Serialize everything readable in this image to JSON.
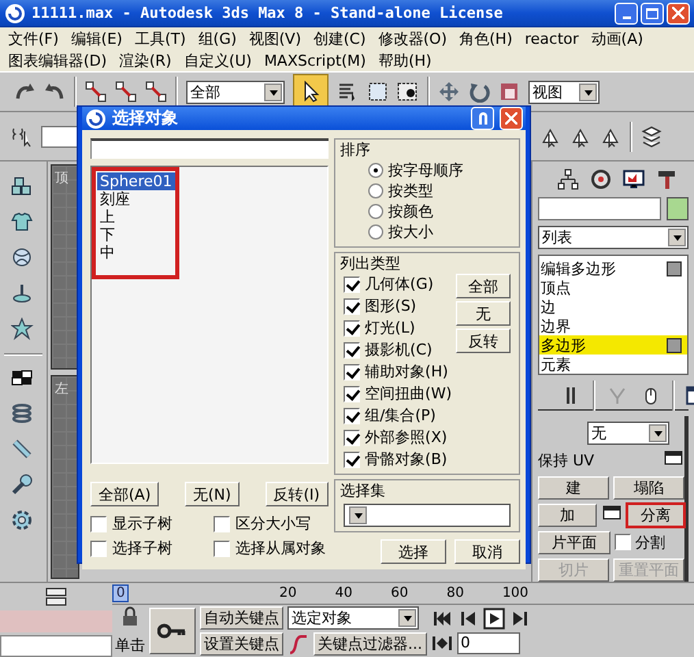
{
  "window": {
    "title": "11111.max - Autodesk 3ds Max 8  - Stand-alone License"
  },
  "menus": [
    [
      "文件(F)",
      "编辑(E)",
      "工具(T)",
      "组(G)",
      "视图(V)",
      "创建(C)",
      "修改器(O)",
      "角色(H)",
      "reactor",
      "动画(A)"
    ],
    [
      "图表编辑器(D)",
      "渲染(R)",
      "自定义(U)",
      "MAXScript(M)",
      "帮助(H)"
    ]
  ],
  "toolbar": {
    "selection_filter": "全部",
    "reference_coordinate": "视图"
  },
  "viewports": [
    {
      "label": "顶"
    },
    {
      "label": "左"
    }
  ],
  "command_panel": {
    "object": {
      "color": "#a8d890"
    },
    "modifier_list": "列表",
    "stack": [
      {
        "label": "编辑多边形",
        "kind": "modifier",
        "selected": false
      },
      {
        "label": "顶点",
        "kind": "subobject",
        "selected": false
      },
      {
        "label": "边",
        "kind": "subobject",
        "selected": false
      },
      {
        "label": "边界",
        "kind": "subobject",
        "selected": false
      },
      {
        "label": "多边形",
        "kind": "subobject",
        "selected": true
      },
      {
        "label": "元素",
        "kind": "subobject",
        "selected": false
      }
    ],
    "rollout": {
      "dropdown": "无",
      "rows": [
        [
          {
            "kind": "text",
            "label": "保持 UV"
          },
          {
            "kind": "icon_button"
          }
        ],
        [
          {
            "kind": "button",
            "label": "建",
            "disabled": false,
            "annotated": false
          },
          {
            "kind": "button",
            "label": "塌陷",
            "disabled": false,
            "annotated": false
          }
        ],
        [
          {
            "kind": "button",
            "label": "加",
            "disabled": false,
            "annotated": false
          },
          {
            "kind": "icon_button"
          },
          {
            "kind": "button",
            "label": "分离",
            "disabled": false,
            "annotated": true
          }
        ],
        [
          {
            "kind": "button",
            "label": "片平面",
            "disabled": false,
            "annotated": false
          },
          {
            "kind": "checkbox",
            "label": "分割",
            "checked": false
          }
        ],
        [
          {
            "kind": "button",
            "label": "切片",
            "disabled": true,
            "annotated": false
          },
          {
            "kind": "button",
            "label": "重置平面",
            "disabled": true,
            "annotated": false
          }
        ]
      ]
    }
  },
  "timeline": {
    "slider": "0",
    "level": 0,
    "ticks": [
      "20",
      "40",
      "60",
      "80",
      "100"
    ]
  },
  "animation": {
    "prompt": "单击",
    "auto_key": "自动关键点",
    "set_key": "设置关键点",
    "key_mode": "选定对象",
    "key_filters": "关键点过滤器...",
    "frame": "0"
  },
  "dialog": {
    "title": "选择对象",
    "list_annotated": true,
    "objects": [
      {
        "name": "Sphere01",
        "selected": true
      },
      {
        "name": "刻座",
        "selected": false
      },
      {
        "name": "上",
        "selected": false
      },
      {
        "name": "下",
        "selected": false
      },
      {
        "name": "中",
        "selected": false
      }
    ],
    "list_buttons": [
      "全部(A)",
      "无(N)",
      "反转(I)"
    ],
    "options": [
      {
        "label": "显示子树",
        "checked": false
      },
      {
        "label": "区分大小写",
        "checked": false
      },
      {
        "label": "选择子树",
        "checked": false
      },
      {
        "label": "选择从属对象",
        "checked": false
      }
    ],
    "sort": {
      "title": "排序",
      "options": [
        {
          "label": "按字母顺序",
          "selected": true
        },
        {
          "label": "按类型",
          "selected": false
        },
        {
          "label": "按颜色",
          "selected": false
        },
        {
          "label": "按大小",
          "selected": false
        }
      ]
    },
    "list_types": {
      "title": "列出类型",
      "types": [
        {
          "label": "几何体(G)",
          "checked": true
        },
        {
          "label": "图形(S)",
          "checked": true
        },
        {
          "label": "灯光(L)",
          "checked": true
        },
        {
          "label": "摄影机(C)",
          "checked": true
        },
        {
          "label": "辅助对象(H)",
          "checked": true
        },
        {
          "label": "空间扭曲(W)",
          "checked": true
        },
        {
          "label": "组/集合(P)",
          "checked": true
        },
        {
          "label": "外部参照(X)",
          "checked": true
        },
        {
          "label": "骨骼对象(B)",
          "checked": true
        }
      ],
      "buttons": [
        "全部",
        "无",
        "反转"
      ]
    },
    "selection_sets": {
      "title": "选择集"
    },
    "buttons": [
      "选择",
      "取消"
    ]
  }
}
